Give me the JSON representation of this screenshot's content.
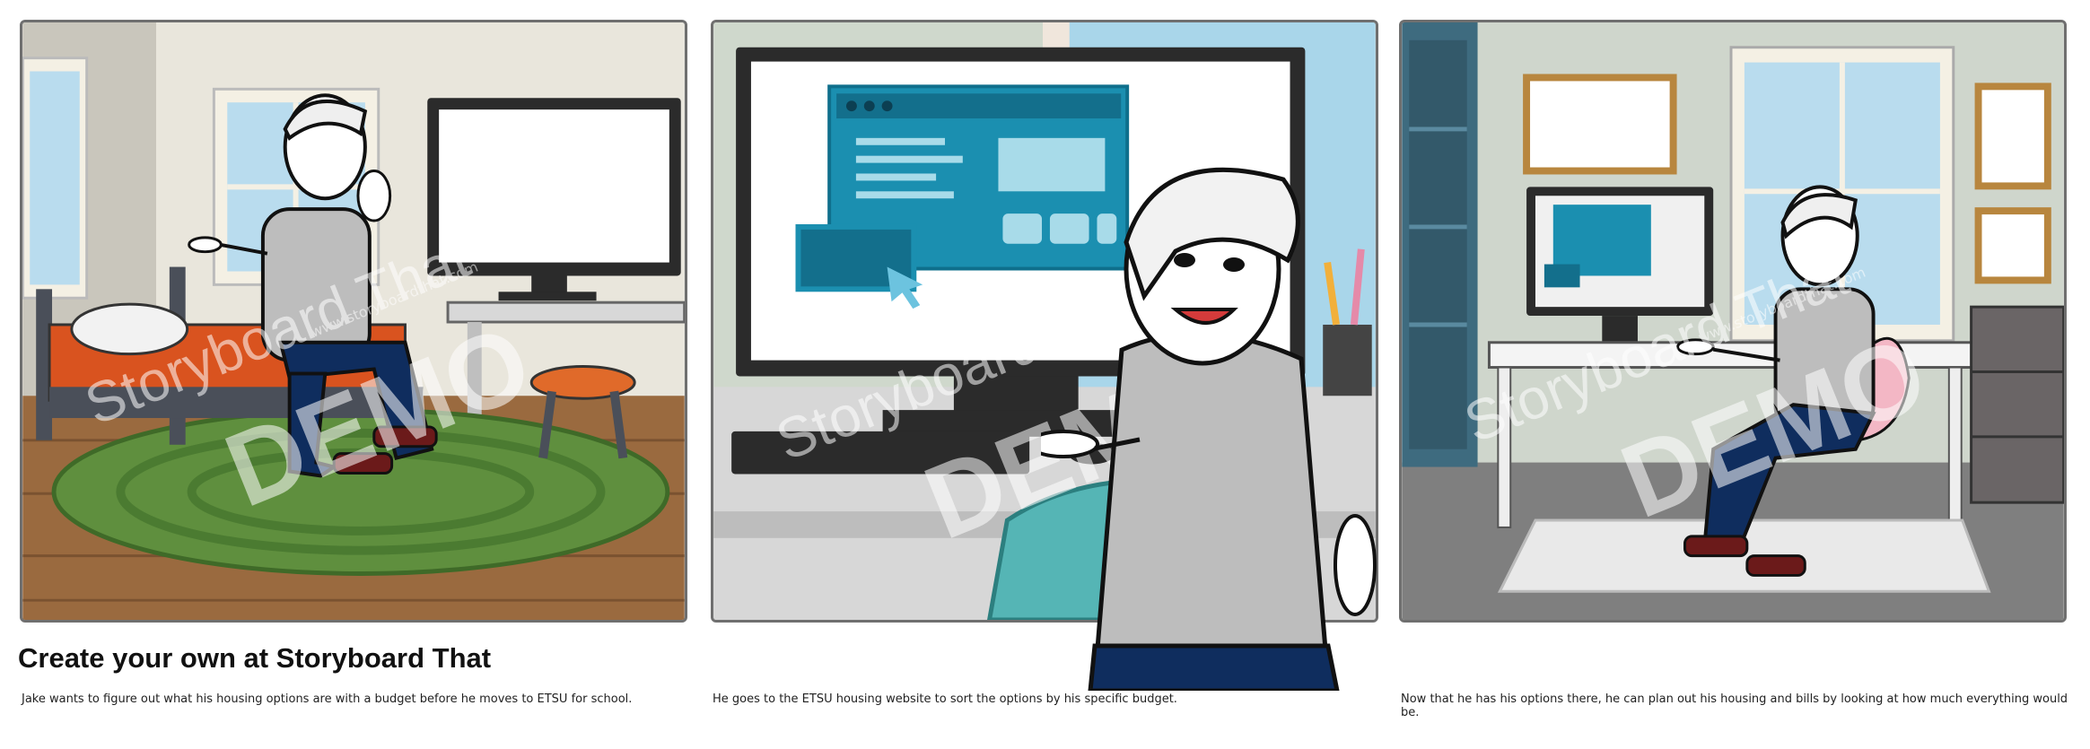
{
  "promo": {
    "text": "Create your own at Storyboard That"
  },
  "watermark": {
    "brand": "Storyboard That",
    "demo": "DEMO",
    "url": "www.storyboardthat.com"
  },
  "panels": [
    {
      "caption": "Jake wants to figure out what his housing options are with a budget before he moves to ETSU for school."
    },
    {
      "caption": "He goes to the ETSU housing website to sort the options by his specific budget."
    },
    {
      "caption": "Now that he has his options there, he can plan out his housing and bills by looking at how much everything would be."
    }
  ],
  "colors": {
    "panel_border": "#6f6f6f",
    "web_teal": "#1b8fb0",
    "shirt": "#bdbdbd",
    "jeans": "#0f2d5e"
  }
}
